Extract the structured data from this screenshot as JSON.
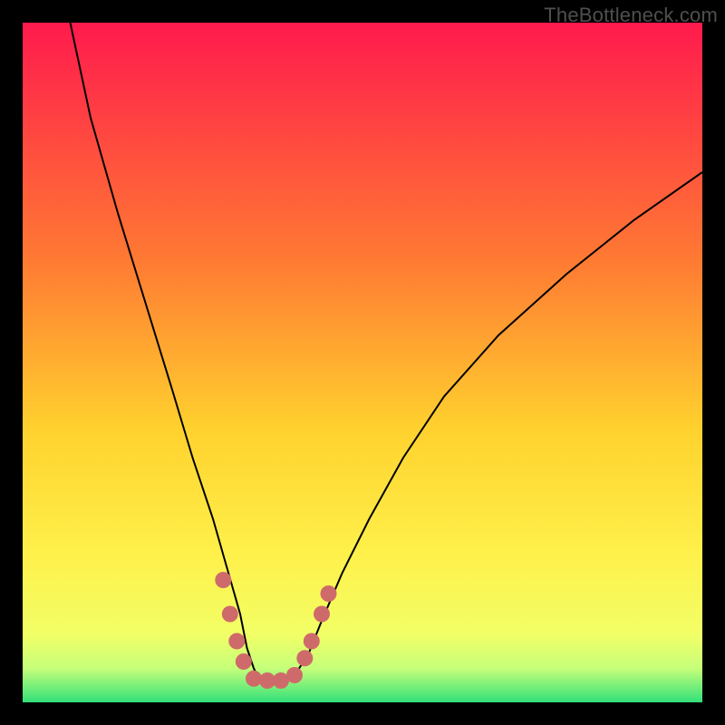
{
  "watermark": "TheBottleneck.com",
  "chart_data": {
    "type": "line",
    "title": "",
    "xlabel": "",
    "ylabel": "",
    "xlim": [
      0,
      100
    ],
    "ylim": [
      0,
      100
    ],
    "grid": false,
    "legend": false,
    "background": {
      "gradient_stops": [
        {
          "offset": 0.0,
          "color": "#ff1a4d"
        },
        {
          "offset": 0.35,
          "color": "#ff7a33"
        },
        {
          "offset": 0.6,
          "color": "#ffd22e"
        },
        {
          "offset": 0.78,
          "color": "#fff04a"
        },
        {
          "offset": 0.9,
          "color": "#f2ff66"
        },
        {
          "offset": 0.95,
          "color": "#c6ff7a"
        },
        {
          "offset": 1.0,
          "color": "#33e07a"
        }
      ]
    },
    "series": [
      {
        "name": "bottleneck-curve",
        "color": "#000000",
        "x": [
          7,
          10,
          14,
          18,
          22,
          25,
          28,
          30,
          32,
          33,
          34,
          35,
          36,
          38,
          40,
          42,
          44,
          47,
          51,
          56,
          62,
          70,
          80,
          90,
          100
        ],
        "values": [
          100,
          86,
          72,
          59,
          46,
          36,
          27,
          20,
          13,
          8,
          5,
          3,
          3,
          3,
          4,
          7,
          12,
          19,
          27,
          36,
          45,
          54,
          63,
          71,
          78
        ]
      }
    ],
    "markers": {
      "name": "highlighted-points",
      "color": "#cf6a6a",
      "points": [
        {
          "x": 29.5,
          "y": 18
        },
        {
          "x": 30.5,
          "y": 13
        },
        {
          "x": 31.5,
          "y": 9
        },
        {
          "x": 32.5,
          "y": 6
        },
        {
          "x": 34.0,
          "y": 3.5
        },
        {
          "x": 36.0,
          "y": 3.2
        },
        {
          "x": 38.0,
          "y": 3.2
        },
        {
          "x": 40.0,
          "y": 4
        },
        {
          "x": 41.5,
          "y": 6.5
        },
        {
          "x": 42.5,
          "y": 9
        },
        {
          "x": 44.0,
          "y": 13
        },
        {
          "x": 45.0,
          "y": 16
        }
      ]
    }
  }
}
